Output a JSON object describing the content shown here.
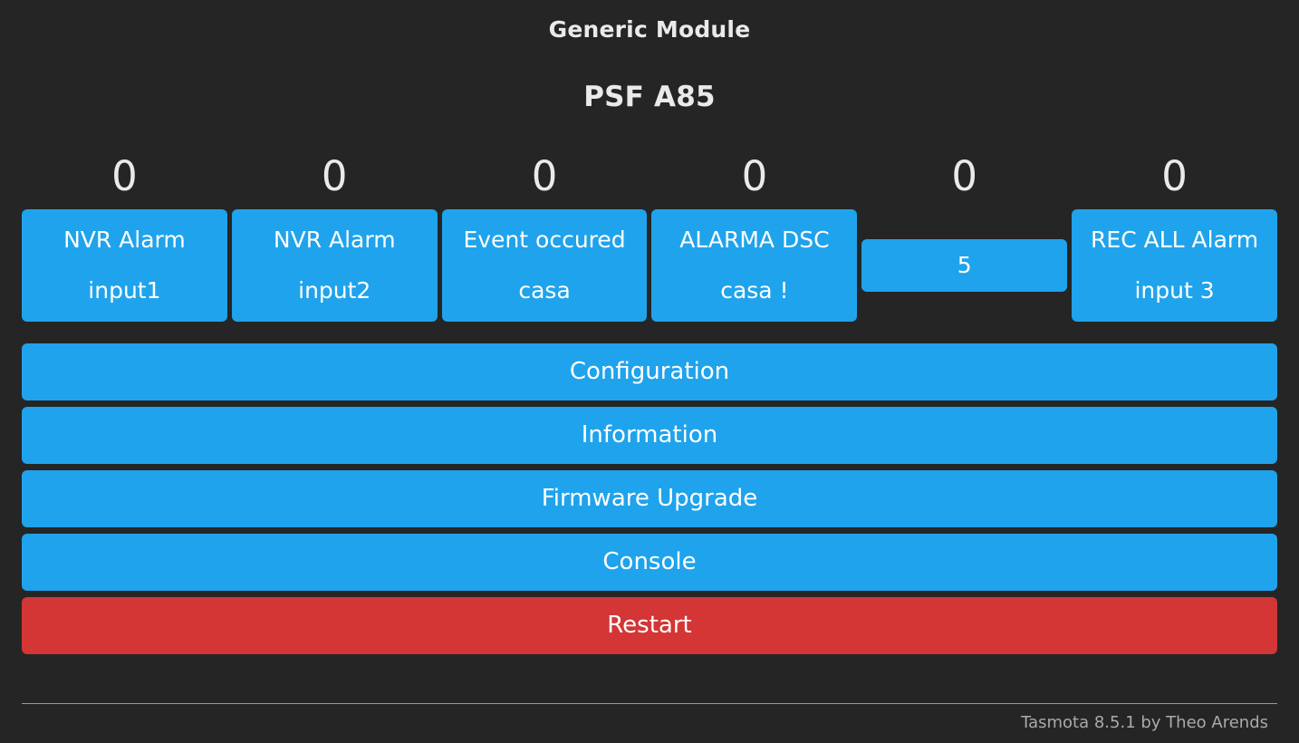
{
  "header": {
    "module_title": "Generic Module",
    "device_name": "PSF A85"
  },
  "colors": {
    "background": "#252525",
    "button": "#1fa3ec",
    "button_danger": "#d43535",
    "text": "#eaeaea",
    "button_text": "#ffffff",
    "footer_text": "#aaaaaa"
  },
  "status_values": [
    "0",
    "0",
    "0",
    "0",
    "0",
    "0"
  ],
  "toggles": [
    {
      "line1": "NVR Alarm",
      "line2": "input1",
      "single_line": false
    },
    {
      "line1": "NVR Alarm",
      "line2": "input2",
      "single_line": false
    },
    {
      "line1": "Event occured",
      "line2": "casa",
      "single_line": false
    },
    {
      "line1": "ALARMA DSC",
      "line2": "casa !",
      "single_line": false
    },
    {
      "line1": "5",
      "line2": "",
      "single_line": true
    },
    {
      "line1": "REC ALL Alarm",
      "line2": "input 3",
      "single_line": false
    }
  ],
  "menu": [
    {
      "label": "Configuration",
      "style": "primary"
    },
    {
      "label": "Information",
      "style": "primary"
    },
    {
      "label": "Firmware Upgrade",
      "style": "primary"
    },
    {
      "label": "Console",
      "style": "primary"
    },
    {
      "label": "Restart",
      "style": "danger"
    }
  ],
  "footer": {
    "text": "Tasmota 8.5.1 by Theo Arends"
  }
}
